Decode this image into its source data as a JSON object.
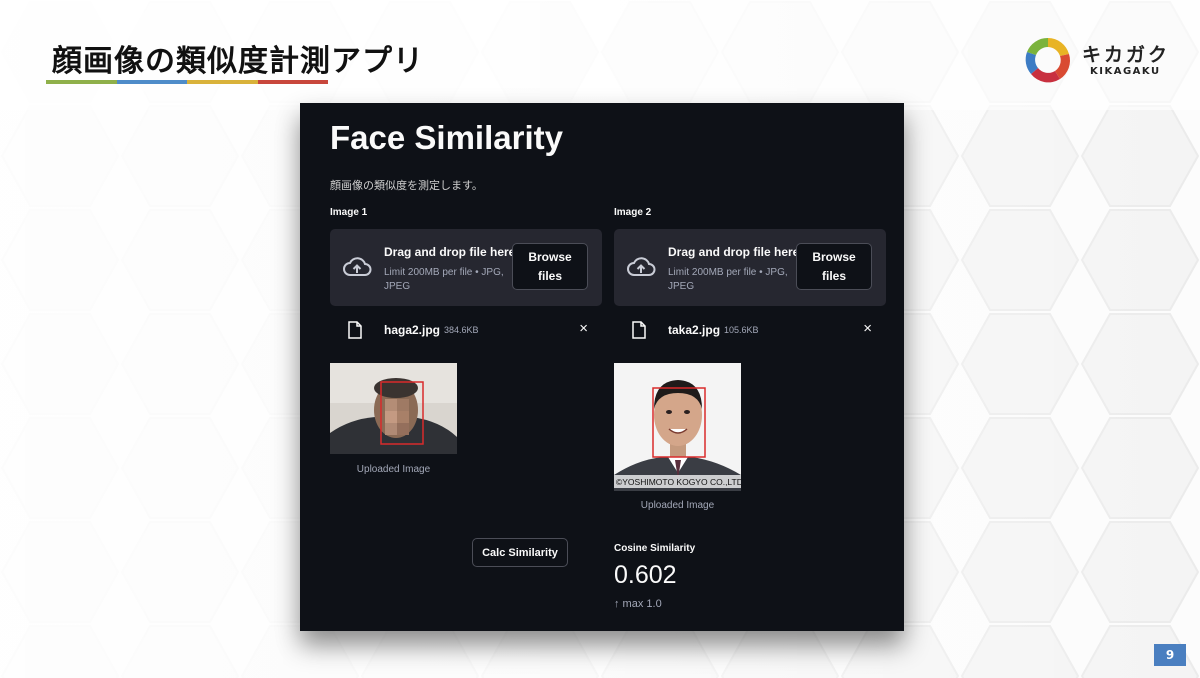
{
  "slide": {
    "title": "顔画像の類似度計測アプリ",
    "title_bar_colors": [
      "#8fb04a",
      "#4f8cc9",
      "#d9b23a",
      "#c8473c"
    ],
    "page_number": "9",
    "logo": {
      "jp": "キカガク",
      "en": "KIKAGAKU",
      "icon": "kikagaku-ring-logo"
    }
  },
  "app": {
    "title": "Face Similarity",
    "description": "顔画像の類似度を測定します。",
    "image1": {
      "label": "Image 1",
      "dropzone_title": "Drag and drop file here",
      "dropzone_limit": "Limit 200MB per file • JPG, JPEG",
      "browse_label_line1": "Browse",
      "browse_label_line2": "files",
      "file_name": "haga2.jpg",
      "file_size": "384.6KB",
      "remove_icon": "×",
      "caption": "Uploaded Image"
    },
    "image2": {
      "label": "Image 2",
      "dropzone_title": "Drag and drop file here",
      "dropzone_limit": "Limit 200MB per file • JPG, JPEG",
      "browse_label_line1": "Browse",
      "browse_label_line2": "files",
      "file_name": "taka2.jpg",
      "file_size": "105.6KB",
      "remove_icon": "×",
      "caption": "Uploaded Image",
      "watermark": "©YOSHIMOTO KOGYO CO.,LTD."
    },
    "calc_button": "Calc Similarity",
    "metric": {
      "label": "Cosine Similarity",
      "value": "0.602",
      "delta": "↑ max 1.0"
    },
    "colors": {
      "background": "#0e1117",
      "panel": "#262730",
      "text": "#fafafa",
      "muted": "#a3a8b8",
      "face_box": "#d92b2b"
    }
  }
}
